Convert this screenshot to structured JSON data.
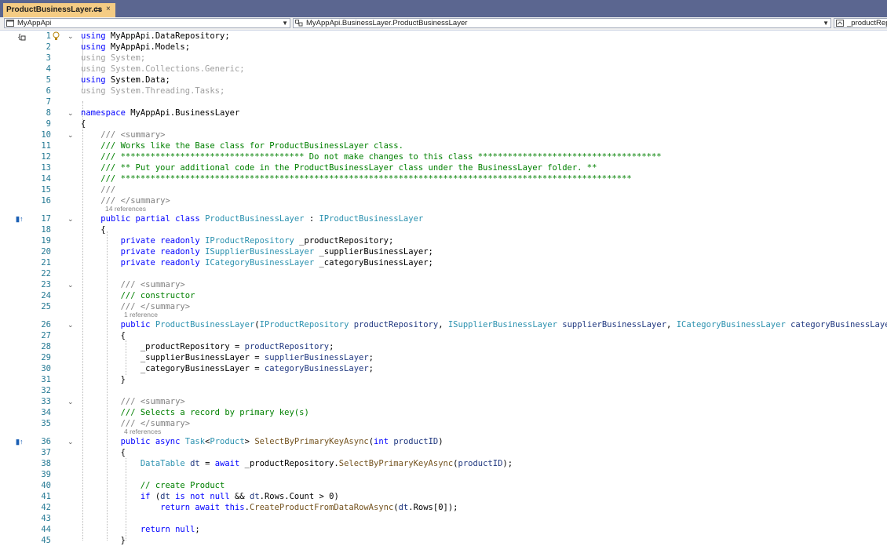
{
  "tab": {
    "title": "ProductBusinessLayer.cs",
    "pin": "⇆",
    "close": "×"
  },
  "nav": {
    "project": "MyAppApi",
    "class": "MyAppApi.BusinessLayer.ProductBusinessLayer",
    "member": "_productRepository"
  },
  "colors": {
    "keyword": "#0000ff",
    "type": "#2b91af",
    "comment": "#008000",
    "line_number": "#237893",
    "tab_active": "#f5cc84",
    "tabbar": "#5b6690"
  },
  "references": [
    "14 references",
    "1 reference",
    "4 references"
  ],
  "lines": [
    {
      "n": "1",
      "text": "using MyAppApi.DataRepository;"
    },
    {
      "n": "2",
      "text": "using MyAppApi.Models;"
    },
    {
      "n": "3",
      "text": "using System;"
    },
    {
      "n": "4",
      "text": "using System.Collections.Generic;"
    },
    {
      "n": "5",
      "text": "using System.Data;"
    },
    {
      "n": "6",
      "text": "using System.Threading.Tasks;"
    },
    {
      "n": "7",
      "text": ""
    },
    {
      "n": "8",
      "text": "namespace MyAppApi.BusinessLayer"
    },
    {
      "n": "9",
      "text": "{"
    },
    {
      "n": "10",
      "text": "    /// <summary>"
    },
    {
      "n": "11",
      "text": "    /// Works like the Base class for ProductBusinessLayer class."
    },
    {
      "n": "12",
      "text": "    /// ************************************* Do not make changes to this class *************************************"
    },
    {
      "n": "13",
      "text": "    /// ** Put your additional code in the ProductBusinessLayer class under the BusinessLayer folder. **"
    },
    {
      "n": "14",
      "text": "    /// *******************************************************************************************************"
    },
    {
      "n": "15",
      "text": "    ///"
    },
    {
      "n": "16",
      "text": "    /// </summary>"
    },
    {
      "n": "17",
      "text": "    public partial class ProductBusinessLayer : IProductBusinessLayer"
    },
    {
      "n": "18",
      "text": "    {"
    },
    {
      "n": "19",
      "text": "        private readonly IProductRepository _productRepository;"
    },
    {
      "n": "20",
      "text": "        private readonly ISupplierBusinessLayer _supplierBusinessLayer;"
    },
    {
      "n": "21",
      "text": "        private readonly ICategoryBusinessLayer _categoryBusinessLayer;"
    },
    {
      "n": "22",
      "text": ""
    },
    {
      "n": "23",
      "text": "        /// <summary>"
    },
    {
      "n": "24",
      "text": "        /// constructor"
    },
    {
      "n": "25",
      "text": "        /// </summary>"
    },
    {
      "n": "26",
      "text": "        public ProductBusinessLayer(IProductRepository productRepository, ISupplierBusinessLayer supplierBusinessLayer, ICategoryBusinessLayer categoryBusinessLayer)"
    },
    {
      "n": "27",
      "text": "        {"
    },
    {
      "n": "28",
      "text": "            _productRepository = productRepository;"
    },
    {
      "n": "29",
      "text": "            _supplierBusinessLayer = supplierBusinessLayer;"
    },
    {
      "n": "30",
      "text": "            _categoryBusinessLayer = categoryBusinessLayer;"
    },
    {
      "n": "31",
      "text": "        }"
    },
    {
      "n": "32",
      "text": ""
    },
    {
      "n": "33",
      "text": "        /// <summary>"
    },
    {
      "n": "34",
      "text": "        /// Selects a record by primary key(s)"
    },
    {
      "n": "35",
      "text": "        /// </summary>"
    },
    {
      "n": "36",
      "text": "        public async Task<Product> SelectByPrimaryKeyAsync(int productID)"
    },
    {
      "n": "37",
      "text": "        {"
    },
    {
      "n": "38",
      "text": "            DataTable dt = await _productRepository.SelectByPrimaryKeyAsync(productID);"
    },
    {
      "n": "39",
      "text": ""
    },
    {
      "n": "40",
      "text": "            // create Product"
    },
    {
      "n": "41",
      "text": "            if (dt is not null && dt.Rows.Count > 0)"
    },
    {
      "n": "42",
      "text": "                return await this.CreateProductFromDataRowAsync(dt.Rows[0]);"
    },
    {
      "n": "43",
      "text": ""
    },
    {
      "n": "44",
      "text": "            return null;"
    },
    {
      "n": "45",
      "text": "        }"
    }
  ]
}
